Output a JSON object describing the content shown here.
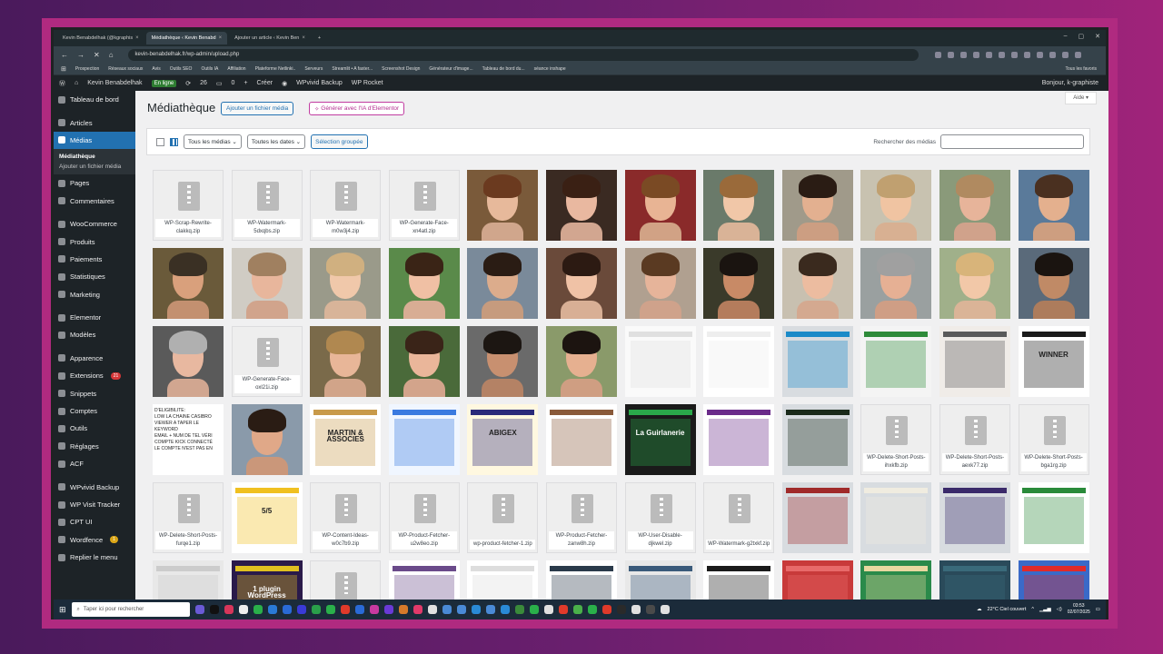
{
  "browser": {
    "tabs": [
      {
        "label": "Kevin Benabdelhak (@kgraphis",
        "active": false
      },
      {
        "label": "Médiathèque ‹ Kevin Benabd",
        "active": true
      },
      {
        "label": "Ajouter un article ‹ Kevin Ben",
        "active": false
      }
    ],
    "url": "kevin-benabdelhak.fr/wp-admin/upload.php",
    "bookmarks": [
      "Prospection",
      "Réseaux sociaux",
      "Avis",
      "Outils SEO",
      "Outils IA",
      "Affiliation",
      "Plateforme Netlinki..",
      "Serveurs",
      "Streamlit • A faster...",
      "Screenshot Design",
      "Générateur d'image...",
      "Tableau de bord du...",
      "séance inshape"
    ],
    "bookmarks_right": "Tous les favoris"
  },
  "adminbar": {
    "site": "Kevin Benabdelhak",
    "status": "En ligne",
    "updates": "26",
    "comments": "0",
    "new": "Créer",
    "plugin1": "WPvivid Backup",
    "plugin2": "WP Rocket",
    "greeting": "Bonjour, k-graphiste"
  },
  "sidebar": {
    "items": [
      {
        "label": "Tableau de bord",
        "icon": "dashboard-icon"
      },
      {
        "label": "Articles",
        "icon": "pin-icon"
      },
      {
        "label": "Médias",
        "icon": "media-icon",
        "active": true
      },
      {
        "label": "Pages",
        "icon": "page-icon"
      },
      {
        "label": "Commentaires",
        "icon": "comment-icon"
      },
      {
        "label": "WooCommerce",
        "icon": "woo-icon"
      },
      {
        "label": "Produits",
        "icon": "box-icon"
      },
      {
        "label": "Paiements",
        "icon": "money-icon"
      },
      {
        "label": "Statistiques",
        "icon": "chart-icon"
      },
      {
        "label": "Marketing",
        "icon": "megaphone-icon"
      },
      {
        "label": "Elementor",
        "icon": "elementor-icon"
      },
      {
        "label": "Modèles",
        "icon": "folder-icon"
      },
      {
        "label": "Apparence",
        "icon": "brush-icon"
      },
      {
        "label": "Extensions",
        "icon": "plugin-icon",
        "badge": "21"
      },
      {
        "label": "Snippets",
        "icon": "scissors-icon"
      },
      {
        "label": "Comptes",
        "icon": "user-icon"
      },
      {
        "label": "Outils",
        "icon": "wrench-icon"
      },
      {
        "label": "Réglages",
        "icon": "settings-icon"
      },
      {
        "label": "ACF",
        "icon": "acf-icon"
      },
      {
        "label": "WPvivid Backup",
        "icon": "backup-icon"
      },
      {
        "label": "WP Visit Tracker",
        "icon": "tracker-icon"
      },
      {
        "label": "CPT UI",
        "icon": "cpt-icon"
      },
      {
        "label": "Wordfence",
        "icon": "shield-icon",
        "badge": "1"
      },
      {
        "label": "Replier le menu",
        "icon": "collapse-icon"
      }
    ],
    "submenu": [
      "Médiathèque",
      "Ajouter un fichier média"
    ]
  },
  "main": {
    "title": "Médiathèque",
    "add_button": "Ajouter un fichier média",
    "ai_button": "Générer avec l'IA d'Elementor",
    "help": "Aide",
    "filter_type": "Tous les médias",
    "filter_date": "Toutes les dates",
    "bulk": "Sélection groupée",
    "search_label": "Rechercher des médias"
  },
  "media": [
    {
      "type": "zip",
      "name": "WP-Scrap-Rewrite-clakkq.zip"
    },
    {
      "type": "zip",
      "name": "WP-Watermark-5dxqbs.zip"
    },
    {
      "type": "zip",
      "name": "WP-Watermark-m0w3j4.zip"
    },
    {
      "type": "zip",
      "name": "WP-Generate-Face-xn4atl.zip"
    },
    {
      "type": "face",
      "bg": "#7a5a3a",
      "skin": "#e7b99b",
      "hair": "#6b3a1f"
    },
    {
      "type": "face",
      "bg": "#3a2a22",
      "skin": "#e9b8a0",
      "hair": "#3a2014"
    },
    {
      "type": "face",
      "bg": "#8a2a2a",
      "skin": "#e8b494",
      "hair": "#7a4a24"
    },
    {
      "type": "face",
      "bg": "#6a7a6a",
      "skin": "#f1c7a8",
      "hair": "#9a6a3a"
    },
    {
      "type": "face",
      "bg": "#a09a8a",
      "skin": "#e3b090",
      "hair": "#2a1c14"
    },
    {
      "type": "face",
      "bg": "#c8c2b0",
      "skin": "#f0c4a2",
      "hair": "#c0a070"
    },
    {
      "type": "face",
      "bg": "#8a9a7a",
      "skin": "#e7b49a",
      "hair": "#b08a60"
    },
    {
      "type": "face",
      "bg": "#5a7a9a",
      "skin": "#e4b08e",
      "hair": "#4a3020"
    },
    {
      "type": "face",
      "bg": "#6a5a3a",
      "skin": "#d9a07c",
      "hair": "#3a3024"
    },
    {
      "type": "face",
      "bg": "#d0ccc4",
      "skin": "#e8b69c",
      "hair": "#a08060"
    },
    {
      "type": "face",
      "bg": "#9a9a8a",
      "skin": "#f0c8aa",
      "hair": "#d0b080"
    },
    {
      "type": "face",
      "bg": "#5a8a4a",
      "skin": "#f0c0a4",
      "hair": "#3a2416"
    },
    {
      "type": "face",
      "bg": "#7a8a9a",
      "skin": "#dcac8c",
      "hair": "#2a1c14"
    },
    {
      "type": "face",
      "bg": "#6a4a3a",
      "skin": "#f0c2a6",
      "hair": "#2c1a12"
    },
    {
      "type": "face",
      "bg": "#b0a090",
      "skin": "#e6b49a",
      "hair": "#5a3a22"
    },
    {
      "type": "face",
      "bg": "#3a3a2a",
      "skin": "#c88a66",
      "hair": "#1a1410"
    },
    {
      "type": "face",
      "bg": "#c8c0b0",
      "skin": "#ecbca0",
      "hair": "#3a2a1e"
    },
    {
      "type": "face",
      "bg": "#9aa0a0",
      "skin": "#e6b094",
      "hair": "#a0a0a0"
    },
    {
      "type": "face",
      "bg": "#a0b08a",
      "skin": "#f2c8a8",
      "hair": "#d8b47a"
    },
    {
      "type": "face",
      "bg": "#5a6a7a",
      "skin": "#c08a66",
      "hair": "#1a1410"
    },
    {
      "type": "face",
      "bg": "#5a5a5a",
      "skin": "#e8b8a0",
      "hair": "#b0b0b0"
    },
    {
      "type": "zip",
      "name": "WP-Generate-Face-oxl21i.zip"
    },
    {
      "type": "face",
      "bg": "#7a6a4a",
      "skin": "#e8b698",
      "hair": "#b08850"
    },
    {
      "type": "face",
      "bg": "#4a6a3a",
      "skin": "#eab69a",
      "hair": "#3a2418"
    },
    {
      "type": "face",
      "bg": "#6a6a6a",
      "skin": "#c89070",
      "hair": "#1c1612"
    },
    {
      "type": "face",
      "bg": "#8a9a6a",
      "skin": "#e6b090",
      "hair": "#1c1410"
    },
    {
      "type": "shot",
      "bg": "#fafafa",
      "accent": "#e0e0e0"
    },
    {
      "type": "shot",
      "bg": "#ffffff",
      "accent": "#eeeeee"
    },
    {
      "type": "shot",
      "bg": "#d8dce0",
      "accent": "#1a8ac8"
    },
    {
      "type": "shot",
      "bg": "#f4f4f4",
      "accent": "#2e8b3a"
    },
    {
      "type": "shot",
      "bg": "#f0ece8",
      "accent": "#5a5a5a"
    },
    {
      "type": "shot",
      "bg": "#ffffff",
      "accent": "#1a1a1a",
      "text": "WINNER"
    },
    {
      "type": "text",
      "text": "D'ÉLIGIBILITE:\nLOW LA CHAINE CASIBRO\nVIEWER A TAPER LE KEYWORD\nEMAIL + NUM DE TEL VÉRI\nCOMPTE KICK CONNECTÉ\nLE COMPTE N'EST PAS EN"
    },
    {
      "type": "face",
      "bg": "#8a9aaa",
      "skin": "#e0a888",
      "hair": "#2a1c14"
    },
    {
      "type": "shot",
      "bg": "#ffffff",
      "accent": "#c89a4a",
      "text": "MARTIN & ASSOCIES"
    },
    {
      "type": "shot",
      "bg": "#f0f6ff",
      "accent": "#3a7ae0"
    },
    {
      "type": "shot",
      "bg": "#fff8e0",
      "accent": "#2a2a7a",
      "text": "ABIGEX"
    },
    {
      "type": "shot",
      "bg": "#ffffff",
      "accent": "#8a5a3a"
    },
    {
      "type": "shot",
      "bg": "#1a1a1a",
      "accent": "#2aa84a",
      "text": "La Guirlanerie"
    },
    {
      "type": "shot",
      "bg": "#ffffff",
      "accent": "#6a2a8a"
    },
    {
      "type": "shot",
      "bg": "#d8dce0",
      "accent": "#1a2a1a"
    },
    {
      "type": "zip",
      "name": "WP-Delete-Short-Posts-ihxkfb.zip"
    },
    {
      "type": "zip",
      "name": "WP-Delete-Short-Posts-aexk77.zip"
    },
    {
      "type": "zip",
      "name": "WP-Delete-Short-Posts-bga1rg.zip"
    },
    {
      "type": "zip",
      "name": "WP-Delete-Short-Posts-furqe1.zip"
    },
    {
      "type": "shot",
      "bg": "#ffffff",
      "accent": "#f0c020",
      "text": "5/5"
    },
    {
      "type": "zip",
      "name": "WP-Content-Ideas-w0c7b9.zip"
    },
    {
      "type": "zip",
      "name": "WP-Product-Fetcher-u2w8eo.zip"
    },
    {
      "type": "zip",
      "name": "wp-product-fetcher-1.zip"
    },
    {
      "type": "zip",
      "name": "WP-Product-Fetcher-zanw8h.zip"
    },
    {
      "type": "zip",
      "name": "WP-User-Disable-djkwel.zip"
    },
    {
      "type": "zip",
      "name": "WP-Watermark-g2txkf.zip"
    },
    {
      "type": "shot",
      "bg": "#d8dce0",
      "accent": "#a02a2a"
    },
    {
      "type": "shot",
      "bg": "#d8dce0",
      "accent": "#f0ece0"
    },
    {
      "type": "shot",
      "bg": "#d8dce0",
      "accent": "#3a2a6a"
    },
    {
      "type": "shot",
      "bg": "#ffffff",
      "accent": "#2a8a3a"
    },
    {
      "type": "shot",
      "bg": "#e8e8e8",
      "accent": "#cccccc"
    },
    {
      "type": "shot",
      "bg": "#2a1a4a",
      "accent": "#e0c020",
      "text": "1 plugin WordPress"
    },
    {
      "type": "zip",
      "name": ""
    },
    {
      "type": "shot",
      "bg": "#ffffff",
      "accent": "#6a4a8a"
    },
    {
      "type": "shot",
      "bg": "#ffffff",
      "accent": "#dddddd"
    },
    {
      "type": "shot",
      "bg": "#ffffff",
      "accent": "#2a3a4a"
    },
    {
      "type": "shot",
      "bg": "#e8e8e8",
      "accent": "#3a5a7a"
    },
    {
      "type": "shot",
      "bg": "#ffffff",
      "accent": "#1a1a1a"
    },
    {
      "type": "shot",
      "bg": "#c83a3a",
      "accent": "#e86a6a"
    },
    {
      "type": "shot",
      "bg": "#2a8a4a",
      "accent": "#e8d8a0"
    },
    {
      "type": "shot",
      "bg": "#2a4a5a",
      "accent": "#3a6a7a"
    },
    {
      "type": "shot",
      "bg": "#3a6ac8",
      "accent": "#e02a2a"
    }
  ],
  "taskbar": {
    "search_placeholder": "Taper ici pour rechercher",
    "weather": "22°C  Ciel couvert",
    "time": "03:53",
    "date": "02/07/2025"
  }
}
